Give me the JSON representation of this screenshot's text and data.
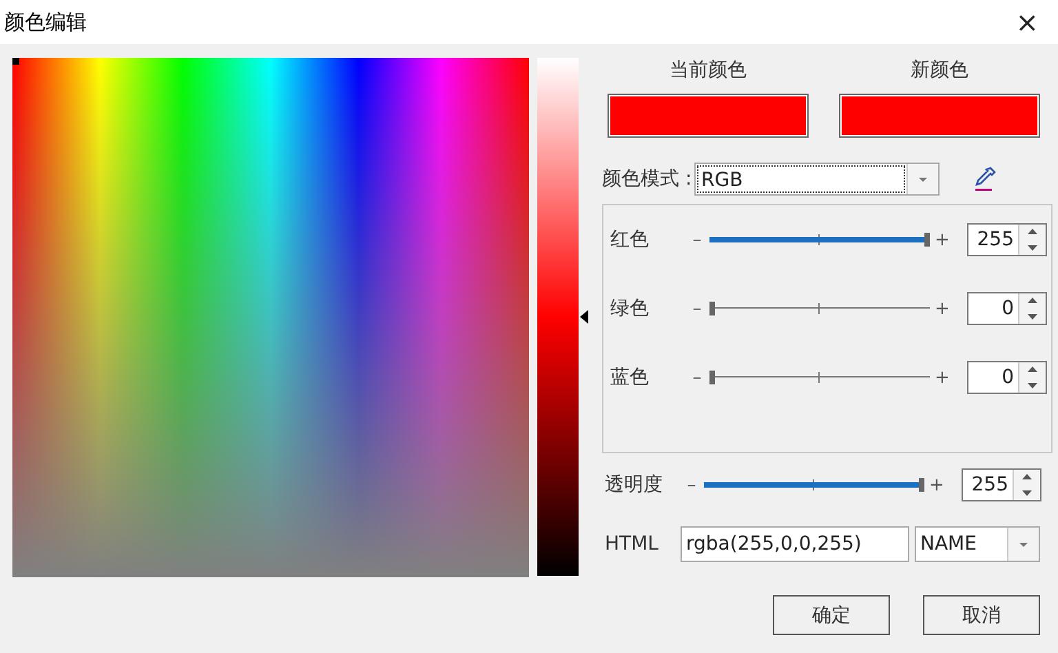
{
  "window": {
    "title": "颜色编辑",
    "close": "×"
  },
  "swatches": [
    {
      "label": "当前颜色",
      "color": "#ff0000"
    },
    {
      "label": "新颜色",
      "color": "#ff0000"
    }
  ],
  "mode": {
    "label": "颜色模式 :",
    "value": "RGB"
  },
  "channels": [
    {
      "label": "红色",
      "minus": "–",
      "plus": "+",
      "level": 1,
      "value": "255"
    },
    {
      "label": "绿色",
      "minus": "–",
      "plus": "+",
      "level": 0,
      "value": "0"
    },
    {
      "label": "蓝色",
      "minus": "–",
      "plus": "+",
      "level": 0,
      "value": "0"
    }
  ],
  "alpha": {
    "label": "透明度",
    "minus": "–",
    "plus": "+",
    "level": 1,
    "value": "255"
  },
  "html": {
    "label": "HTML",
    "value": "rgba(255,0,0,255)",
    "format": "NAME"
  },
  "buttons": [
    "确定",
    "取消"
  ]
}
